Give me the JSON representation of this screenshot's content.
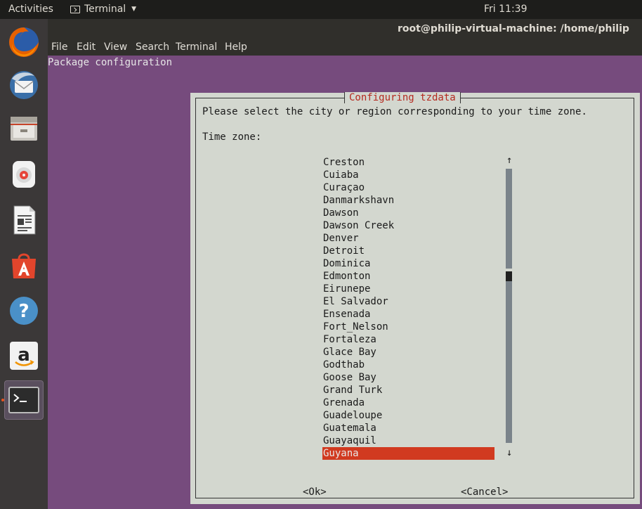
{
  "topbar": {
    "activities": "Activities",
    "app_name": "Terminal",
    "clock": "Fri 11:39"
  },
  "dock": {
    "items": [
      {
        "name": "firefox",
        "icon": "firefox-icon"
      },
      {
        "name": "thunderbird",
        "icon": "thunderbird-icon"
      },
      {
        "name": "files",
        "icon": "files-icon"
      },
      {
        "name": "rhythmbox",
        "icon": "rhythmbox-icon"
      },
      {
        "name": "libreoffice-writer",
        "icon": "writer-icon"
      },
      {
        "name": "software",
        "icon": "software-icon"
      },
      {
        "name": "help",
        "icon": "help-icon"
      },
      {
        "name": "amazon",
        "icon": "amazon-icon"
      },
      {
        "name": "terminal",
        "icon": "terminal-icon"
      }
    ]
  },
  "window": {
    "title": "root@philip-virtual-machine: /home/philip",
    "menu": [
      "File",
      "Edit",
      "View",
      "Search",
      "Terminal",
      "Help"
    ]
  },
  "terminal": {
    "header": "Package configuration"
  },
  "dialog": {
    "title": "Configuring tzdata",
    "prompt": "Please select the city or region corresponding to your time zone.",
    "label": "Time zone:",
    "items": [
      "Creston",
      "Cuiaba",
      "Curaçao",
      "Danmarkshavn",
      "Dawson",
      "Dawson Creek",
      "Denver",
      "Detroit",
      "Dominica",
      "Edmonton",
      "Eirunepe",
      "El Salvador",
      "Ensenada",
      "Fort_Nelson",
      "Fortaleza",
      "Glace Bay",
      "Godthab",
      "Goose Bay",
      "Grand Turk",
      "Grenada",
      "Guadeloupe",
      "Guatemala",
      "Guayaquil",
      "Guyana"
    ],
    "selected": "Guyana",
    "scroll_up": "↑",
    "scroll_down": "↓",
    "ok_label": "<Ok>",
    "cancel_label": "<Cancel>"
  },
  "colors": {
    "terminal_bg": "#764b7d",
    "dialog_bg": "#d3d7cf",
    "selection": "#d13a20",
    "title_text": "#b52a20"
  }
}
